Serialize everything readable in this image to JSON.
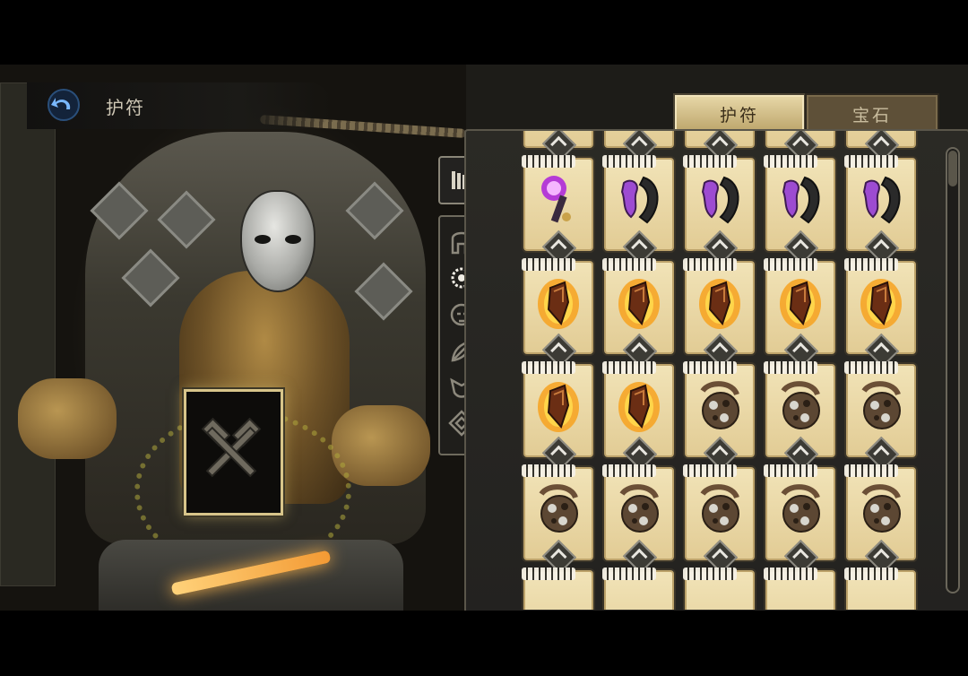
{
  "header": {
    "title": "护符",
    "back_icon": "back-arrow-icon"
  },
  "tabs": [
    {
      "label": "护符",
      "selected": true
    },
    {
      "label": "宝石",
      "selected": false
    }
  ],
  "filters": [
    "all-filter-icon",
    "helmet-icon",
    "holy-sigil-icon",
    "rune-skull-icon",
    "rune-leaf-icon",
    "jester-mask-icon",
    "diamond-rune-icon"
  ],
  "selected_filter": "holy-sigil-icon",
  "equipped_slot": {
    "icon": "crossed-hammers-icon"
  },
  "items": [
    [
      "partial",
      "partial",
      "partial",
      "partial",
      "partial"
    ],
    [
      "purple-scepter",
      "purple-claw",
      "purple-claw",
      "purple-claw",
      "purple-claw"
    ],
    [
      "flame-crystal",
      "flame-crystal",
      "flame-crystal",
      "flame-crystal",
      "flame-crystal"
    ],
    [
      "flame-crystal",
      "flame-crystal",
      "clockwork-orb",
      "clockwork-orb",
      "clockwork-orb"
    ],
    [
      "clockwork-orb",
      "clockwork-orb",
      "clockwork-orb",
      "clockwork-orb",
      "clockwork-orb"
    ],
    [
      "partial",
      "partial",
      "partial",
      "partial",
      "partial"
    ]
  ],
  "colors": {
    "card": "#e2cc95",
    "accent": "#d8c58a",
    "tab_active": "#bda66c"
  }
}
